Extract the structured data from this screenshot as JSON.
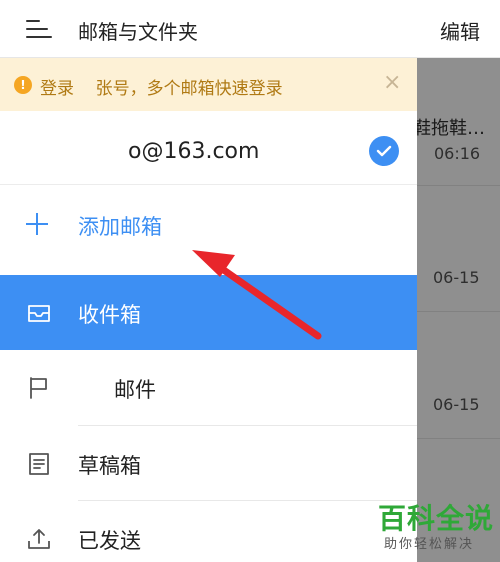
{
  "header": {
    "title": "邮箱与文件夹",
    "edit_label": "编辑",
    "menu_icon": "menu-icon"
  },
  "banner": {
    "text": "登录    张号，多个邮箱快速登录",
    "info_icon": "!",
    "close_icon": "×"
  },
  "account": {
    "email": "o@163.com",
    "selected": true
  },
  "add_mailbox": {
    "label": "添加邮箱"
  },
  "nav": {
    "items": [
      {
        "label": "收件箱",
        "icon": "inbox-icon",
        "selected": true
      },
      {
        "label": "邮件",
        "icon": "flag-icon",
        "selected": false
      },
      {
        "label": "草稿箱",
        "icon": "draft-icon",
        "selected": false
      },
      {
        "label": "已发送",
        "icon": "upload-icon",
        "selected": false
      }
    ]
  },
  "background_list": {
    "items": [
      {
        "subject": "鞋拖鞋…",
        "time": "06:16"
      },
      {
        "time": "06-15"
      },
      {
        "time": "06-15"
      }
    ]
  },
  "watermark": {
    "main": "百科全说",
    "sub": "助你轻松解决"
  },
  "colors": {
    "accent": "#3d8ff3",
    "banner_bg": "#fdf1d6",
    "banner_text": "#b07a14",
    "arrow": "#e8262b",
    "watermark": "#2fa838"
  }
}
